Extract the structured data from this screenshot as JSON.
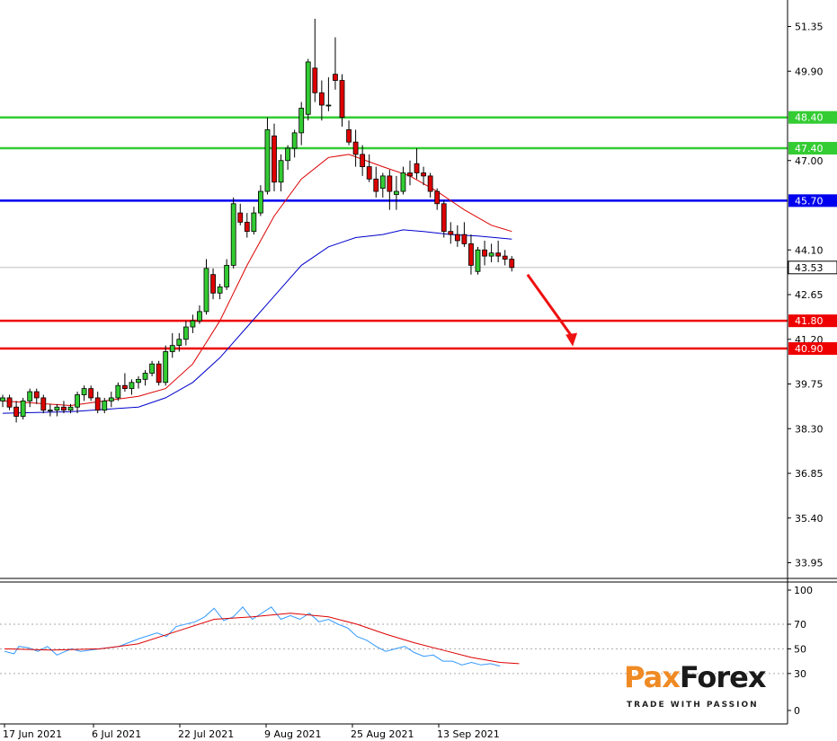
{
  "chart_data": [
    {
      "type": "candlestick",
      "title": "",
      "xlabel": "",
      "ylabel": "",
      "ylim": [
        33.3,
        52.1
      ],
      "y_ticks": [
        "51.35",
        "49.90",
        "47.00",
        "44.10",
        "42.65",
        "41.20",
        "39.75",
        "38.30",
        "36.85",
        "35.40",
        "33.95"
      ],
      "x_tick_labels": [
        "17 Jun 2021",
        "6 Jul 2021",
        "22 Jul 2021",
        "9 Aug 2021",
        "25 Aug 2021",
        "13 Sep 2021"
      ],
      "current_price": "43.53",
      "levels": [
        {
          "value": 48.4,
          "label": "48.40",
          "color": "#33cc33"
        },
        {
          "value": 47.4,
          "label": "47.40",
          "color": "#33cc33"
        },
        {
          "value": 45.7,
          "label": "45.70",
          "color": "#0000ee"
        },
        {
          "value": 41.8,
          "label": "41.80",
          "color": "#ee0000"
        },
        {
          "value": 40.9,
          "label": "40.90",
          "color": "#ee0000"
        }
      ],
      "candles": [
        [
          39.2,
          39.4,
          39.0,
          39.3
        ],
        [
          39.3,
          39.4,
          38.9,
          39.0
        ],
        [
          39.0,
          39.2,
          38.5,
          38.7
        ],
        [
          38.7,
          39.3,
          38.6,
          39.2
        ],
        [
          39.2,
          39.6,
          39.0,
          39.5
        ],
        [
          39.5,
          39.6,
          39.1,
          39.3
        ],
        [
          39.3,
          39.4,
          38.8,
          38.9
        ],
        [
          38.9,
          39.1,
          38.7,
          38.9
        ],
        [
          38.9,
          39.1,
          38.7,
          39.0
        ],
        [
          39.0,
          39.2,
          38.8,
          38.9
        ],
        [
          38.9,
          39.1,
          38.8,
          39.0
        ],
        [
          39.0,
          39.5,
          38.8,
          39.4
        ],
        [
          39.4,
          39.7,
          39.2,
          39.6
        ],
        [
          39.6,
          39.7,
          39.2,
          39.3
        ],
        [
          39.3,
          39.5,
          38.8,
          38.9
        ],
        [
          38.9,
          39.3,
          38.8,
          39.2
        ],
        [
          39.2,
          39.5,
          39.0,
          39.3
        ],
        [
          39.3,
          39.8,
          39.2,
          39.7
        ],
        [
          39.7,
          40.1,
          39.5,
          39.6
        ],
        [
          39.6,
          39.9,
          39.4,
          39.8
        ],
        [
          39.8,
          40.0,
          39.6,
          39.9
        ],
        [
          39.9,
          40.2,
          39.7,
          40.1
        ],
        [
          40.1,
          40.5,
          40.0,
          40.4
        ],
        [
          40.4,
          40.5,
          39.7,
          39.8
        ],
        [
          39.8,
          41.0,
          39.7,
          40.8
        ],
        [
          40.8,
          41.4,
          40.6,
          41.0
        ],
        [
          41.0,
          41.4,
          40.8,
          41.2
        ],
        [
          41.2,
          41.8,
          41.0,
          41.6
        ],
        [
          41.6,
          42.0,
          41.4,
          41.8
        ],
        [
          41.8,
          42.3,
          41.7,
          42.1
        ],
        [
          42.1,
          43.8,
          42.0,
          43.5
        ],
        [
          43.3,
          43.5,
          42.5,
          42.7
        ],
        [
          42.7,
          43.0,
          42.5,
          42.9
        ],
        [
          42.9,
          43.8,
          42.8,
          43.6
        ],
        [
          43.6,
          45.8,
          43.5,
          45.6
        ],
        [
          45.3,
          45.6,
          44.9,
          45.0
        ],
        [
          45.0,
          45.3,
          44.5,
          44.7
        ],
        [
          44.7,
          45.5,
          44.6,
          45.3
        ],
        [
          45.3,
          46.2,
          45.2,
          46.0
        ],
        [
          46.0,
          48.4,
          45.9,
          48.0
        ],
        [
          47.8,
          48.2,
          46.0,
          46.3
        ],
        [
          46.3,
          47.2,
          46.0,
          47.0
        ],
        [
          47.0,
          47.5,
          46.7,
          47.4
        ],
        [
          47.4,
          48.0,
          47.1,
          47.9
        ],
        [
          47.9,
          48.9,
          47.5,
          48.7
        ],
        [
          48.5,
          50.3,
          48.3,
          50.2
        ],
        [
          50.0,
          51.6,
          48.9,
          49.2
        ],
        [
          49.2,
          49.6,
          48.3,
          48.8
        ],
        [
          48.8,
          49.7,
          48.6,
          48.8
        ],
        [
          49.8,
          51.0,
          49.3,
          49.6
        ],
        [
          49.6,
          49.8,
          48.1,
          48.4
        ],
        [
          48.0,
          48.3,
          47.5,
          47.6
        ],
        [
          47.6,
          48.0,
          46.8,
          47.2
        ],
        [
          47.2,
          47.5,
          46.5,
          46.8
        ],
        [
          46.8,
          47.2,
          46.3,
          46.4
        ],
        [
          46.4,
          46.8,
          45.8,
          46.0
        ],
        [
          46.1,
          46.6,
          45.8,
          46.5
        ],
        [
          46.5,
          46.7,
          45.4,
          46.0
        ],
        [
          45.9,
          46.5,
          45.4,
          46.0
        ],
        [
          46.0,
          46.8,
          45.9,
          46.6
        ],
        [
          46.6,
          47.0,
          46.2,
          46.5
        ],
        [
          46.9,
          47.4,
          46.4,
          46.6
        ],
        [
          46.6,
          46.8,
          46.2,
          46.5
        ],
        [
          46.5,
          46.6,
          45.8,
          46.0
        ],
        [
          46.0,
          46.1,
          45.4,
          45.6
        ],
        [
          45.6,
          45.7,
          44.5,
          44.7
        ],
        [
          44.7,
          45.0,
          44.3,
          44.6
        ],
        [
          44.6,
          44.9,
          44.2,
          44.4
        ],
        [
          44.6,
          45.0,
          44.2,
          44.3
        ],
        [
          44.3,
          44.6,
          43.3,
          43.6
        ],
        [
          43.4,
          44.2,
          43.3,
          44.1
        ],
        [
          44.1,
          44.4,
          43.6,
          43.9
        ],
        [
          43.9,
          44.3,
          43.7,
          44.0
        ],
        [
          44.0,
          44.4,
          43.7,
          43.9
        ],
        [
          43.9,
          44.1,
          43.6,
          43.8
        ],
        [
          43.8,
          43.9,
          43.4,
          43.53
        ]
      ],
      "ma_fast": [
        [
          0,
          39.2
        ],
        [
          10,
          39.05
        ],
        [
          20,
          39.35
        ],
        [
          24,
          39.6
        ],
        [
          28,
          40.4
        ],
        [
          32,
          41.8
        ],
        [
          36,
          43.6
        ],
        [
          40,
          45.2
        ],
        [
          44,
          46.4
        ],
        [
          48,
          47.1
        ],
        [
          51,
          47.2
        ],
        [
          56,
          46.8
        ],
        [
          60,
          46.5
        ],
        [
          64,
          46.0
        ],
        [
          68,
          45.4
        ],
        [
          72,
          44.9
        ],
        [
          75,
          44.7
        ]
      ],
      "ma_slow": [
        [
          0,
          38.8
        ],
        [
          10,
          38.85
        ],
        [
          20,
          39.0
        ],
        [
          24,
          39.3
        ],
        [
          28,
          39.8
        ],
        [
          32,
          40.6
        ],
        [
          36,
          41.6
        ],
        [
          40,
          42.6
        ],
        [
          44,
          43.6
        ],
        [
          48,
          44.2
        ],
        [
          52,
          44.5
        ],
        [
          56,
          44.6
        ],
        [
          59,
          44.75
        ],
        [
          62,
          44.7
        ],
        [
          66,
          44.6
        ],
        [
          70,
          44.55
        ],
        [
          75,
          44.45
        ]
      ],
      "projection_arrow": {
        "from": [
          76,
          43.3
        ],
        "to": [
          82,
          41.0
        ]
      }
    },
    {
      "type": "line",
      "title": "",
      "ylim": [
        0,
        100
      ],
      "y_ticks": [
        "100",
        "70",
        "50",
        "30",
        "0"
      ],
      "reference_lines": [
        70,
        50,
        30
      ],
      "series": [
        {
          "color": "#3399ff",
          "values": [
            [
              0,
              48
            ],
            [
              2,
              46
            ],
            [
              3,
              52
            ],
            [
              5,
              51
            ],
            [
              7,
              48
            ],
            [
              9,
              52
            ],
            [
              11,
              45
            ],
            [
              14,
              50
            ],
            [
              16,
              48
            ],
            [
              20,
              50
            ],
            [
              24,
              52
            ],
            [
              28,
              58
            ],
            [
              32,
              63
            ],
            [
              34,
              60
            ],
            [
              36,
              68
            ],
            [
              40,
              72
            ],
            [
              42,
              76
            ],
            [
              44,
              83
            ],
            [
              46,
              73
            ],
            [
              48,
              76
            ],
            [
              50,
              84
            ],
            [
              52,
              74
            ],
            [
              56,
              84
            ],
            [
              58,
              74
            ],
            [
              60,
              77
            ],
            [
              62,
              74
            ],
            [
              64,
              79
            ],
            [
              66,
              72
            ],
            [
              68,
              74
            ],
            [
              70,
              70
            ],
            [
              72,
              67
            ],
            [
              74,
              60
            ],
            [
              76,
              57
            ],
            [
              78,
              52
            ],
            [
              80,
              48
            ],
            [
              82,
              50
            ],
            [
              84,
              52
            ],
            [
              86,
              47
            ],
            [
              88,
              44
            ],
            [
              90,
              45
            ],
            [
              92,
              40
            ],
            [
              94,
              40
            ],
            [
              96,
              37
            ],
            [
              98,
              39
            ],
            [
              100,
              37
            ],
            [
              102,
              38
            ],
            [
              104,
              36
            ]
          ]
        },
        {
          "color": "#dd0000",
          "values": [
            [
              0,
              50
            ],
            [
              10,
              49
            ],
            [
              20,
              50
            ],
            [
              28,
              54
            ],
            [
              36,
              64
            ],
            [
              44,
              74
            ],
            [
              52,
              76
            ],
            [
              60,
              79
            ],
            [
              68,
              76
            ],
            [
              74,
              70
            ],
            [
              80,
              62
            ],
            [
              86,
              55
            ],
            [
              92,
              49
            ],
            [
              98,
              43
            ],
            [
              104,
              39
            ],
            [
              108,
              38
            ]
          ]
        }
      ]
    }
  ],
  "brand": {
    "part1": "Pax",
    "part2": "Forex",
    "tagline": "TRADE WITH PASSION"
  }
}
